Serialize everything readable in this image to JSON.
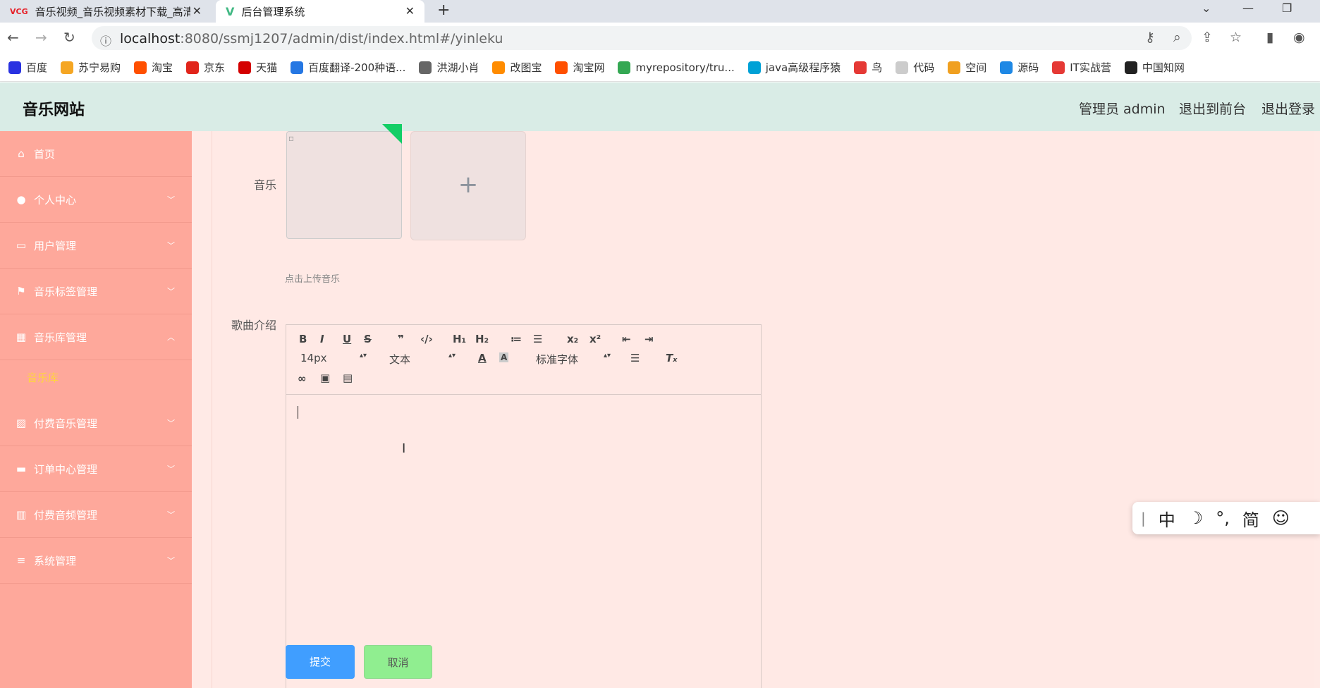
{
  "browser": {
    "tabs": [
      {
        "favicon": "VCG",
        "title": "音乐视频_音乐视频素材下载_高清",
        "close": "✕"
      },
      {
        "favicon": "V",
        "title": "后台管理系统",
        "close": "✕"
      }
    ],
    "new_tab": "+",
    "url_host": "localhost",
    "url_rest": ":8080/ssmj1207/admin/dist/index.html#/yinleku",
    "bookmarks": [
      {
        "label": "百度",
        "icon": "baidu-icon",
        "color": "#2932e1"
      },
      {
        "label": "苏宁易购",
        "icon": "suning-icon",
        "color": "#f5a623"
      },
      {
        "label": "淘宝",
        "icon": "taobao-icon",
        "color": "#ff5000"
      },
      {
        "label": "京东",
        "icon": "jd-icon",
        "color": "#e1251b"
      },
      {
        "label": "天猫",
        "icon": "tmall-icon",
        "color": "#d40000"
      },
      {
        "label": "百度翻译-200种语...",
        "icon": "fanyi-icon",
        "color": "#2577e3"
      },
      {
        "label": "洪湖小肖",
        "icon": "bird-icon",
        "color": "#666666"
      },
      {
        "label": "改图宝",
        "icon": "gaitubao-icon",
        "color": "#ff8c00"
      },
      {
        "label": "淘宝网",
        "icon": "taobaowang-icon",
        "color": "#ff5000"
      },
      {
        "label": "myrepository/tru...",
        "icon": "chrome-icon",
        "color": "#34a853"
      },
      {
        "label": "java高级程序猿",
        "icon": "bilibili-icon",
        "color": "#00a1d6"
      },
      {
        "label": "鸟",
        "icon": "hummingbird-icon",
        "color": "#e53935"
      },
      {
        "label": "代码",
        "icon": "code-icon",
        "color": "#cccccc"
      },
      {
        "label": "空间",
        "icon": "qzone-icon",
        "color": "#f0a020"
      },
      {
        "label": "源码",
        "icon": "fish-icon",
        "color": "#1e88e5"
      },
      {
        "label": "IT实战营",
        "icon": "chrome-red-icon",
        "color": "#e53935"
      },
      {
        "label": "中国知网",
        "icon": "cnki-icon",
        "color": "#222222"
      }
    ]
  },
  "header": {
    "logo": "音乐网站",
    "user": "管理员 admin",
    "to_front": "退出到前台",
    "logout": "退出登录"
  },
  "sidebar": {
    "items": [
      {
        "label": "首页",
        "icon": "home-icon",
        "glyph": "⌂",
        "chevron": ""
      },
      {
        "label": "个人中心",
        "icon": "user-icon",
        "glyph": "●",
        "chevron": "﹀"
      },
      {
        "label": "用户管理",
        "icon": "chat-icon",
        "glyph": "▭",
        "chevron": "﹀"
      },
      {
        "label": "音乐标签管理",
        "icon": "flag-icon",
        "glyph": "⚑",
        "chevron": "﹀"
      },
      {
        "label": "音乐库管理",
        "icon": "grid-icon",
        "glyph": "▦",
        "chevron": "︿"
      },
      {
        "label": "付费音乐管理",
        "icon": "chart-icon",
        "glyph": "▨",
        "chevron": "﹀"
      },
      {
        "label": "订单中心管理",
        "icon": "briefcase-icon",
        "glyph": "▬",
        "chevron": "﹀"
      },
      {
        "label": "付费音频管理",
        "icon": "books-icon",
        "glyph": "▥",
        "chevron": "﹀"
      },
      {
        "label": "系统管理",
        "icon": "list-icon",
        "glyph": "≡",
        "chevron": "﹀"
      }
    ],
    "subitem": "音乐库"
  },
  "form": {
    "music_label": "音乐",
    "upload_plus": "+",
    "upload_hint": "点击上传音乐",
    "intro_label": "歌曲介绍",
    "submit": "提交",
    "cancel": "取消"
  },
  "editor": {
    "size_value": "14px",
    "header_value": "文本",
    "font_value": "标准字体",
    "buttons": [
      "B",
      "I",
      "U",
      "S",
      "❞",
      "‹/›",
      "H₁",
      "H₂",
      "≔",
      "☰",
      "x₂",
      "x²",
      "⇤",
      "⇥"
    ]
  },
  "ime": {
    "items": [
      "|",
      "中",
      "☽",
      "°,",
      "简",
      "☺"
    ]
  },
  "colors": {
    "sidebar": "#fea89b",
    "header": "#d9ece6",
    "submit": "#409eff",
    "cancel": "#90ee90",
    "active_sub": "#ffd53d"
  }
}
